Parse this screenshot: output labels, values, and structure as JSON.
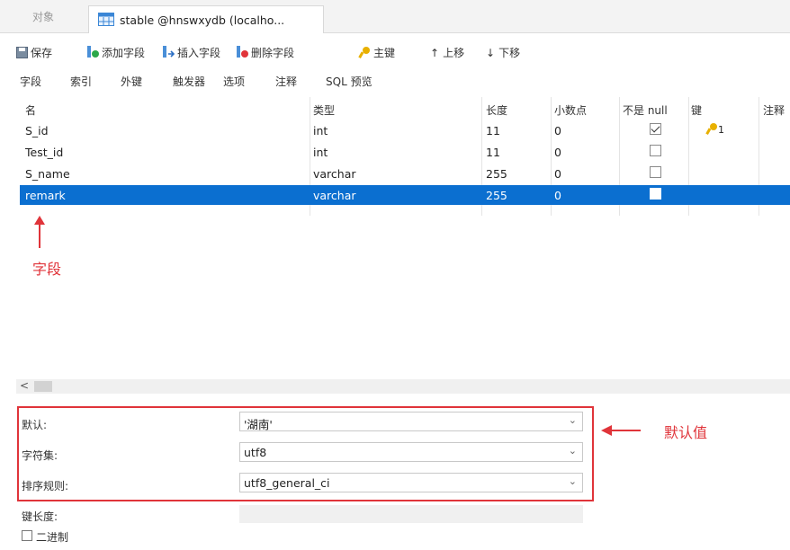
{
  "tabs": {
    "object": "对象",
    "active": "stable @hnswxydb (localho..."
  },
  "toolbar": {
    "save": "保存",
    "add_field": "添加字段",
    "insert_field": "插入字段",
    "delete_field": "删除字段",
    "primary_key": "主键",
    "move_up": "上移",
    "move_down": "下移"
  },
  "subtabs": [
    "字段",
    "索引",
    "外键",
    "触发器",
    "选项",
    "注释",
    "SQL 预览"
  ],
  "grid": {
    "headers": {
      "name": "名",
      "type": "类型",
      "length": "长度",
      "decimals": "小数点",
      "not_null": "不是 null",
      "key": "键",
      "comment": "注释"
    },
    "rows": [
      {
        "name": "S_id",
        "type": "int",
        "length": "11",
        "decimals": "0",
        "not_null": true,
        "key": "1"
      },
      {
        "name": "Test_id",
        "type": "int",
        "length": "11",
        "decimals": "0",
        "not_null": false,
        "key": ""
      },
      {
        "name": "S_name",
        "type": "varchar",
        "length": "255",
        "decimals": "0",
        "not_null": false,
        "key": ""
      },
      {
        "name": "remark",
        "type": "varchar",
        "length": "255",
        "decimals": "0",
        "not_null": false,
        "key": "",
        "selected": true
      }
    ]
  },
  "annotations": {
    "field_label": "字段",
    "default_label": "默认值"
  },
  "scroll": {
    "left_arrow": "<"
  },
  "properties": {
    "default_label": "默认:",
    "default_value": "'湖南'",
    "charset_label": "字符集:",
    "charset_value": "utf8",
    "collation_label": "排序规则:",
    "collation_value": "utf8_general_ci",
    "key_length_label": "键长度:",
    "binary_label": "二进制"
  },
  "colors": {
    "selection": "#0b6fd0",
    "annotation": "#e0343a",
    "key": "#e8b000"
  }
}
